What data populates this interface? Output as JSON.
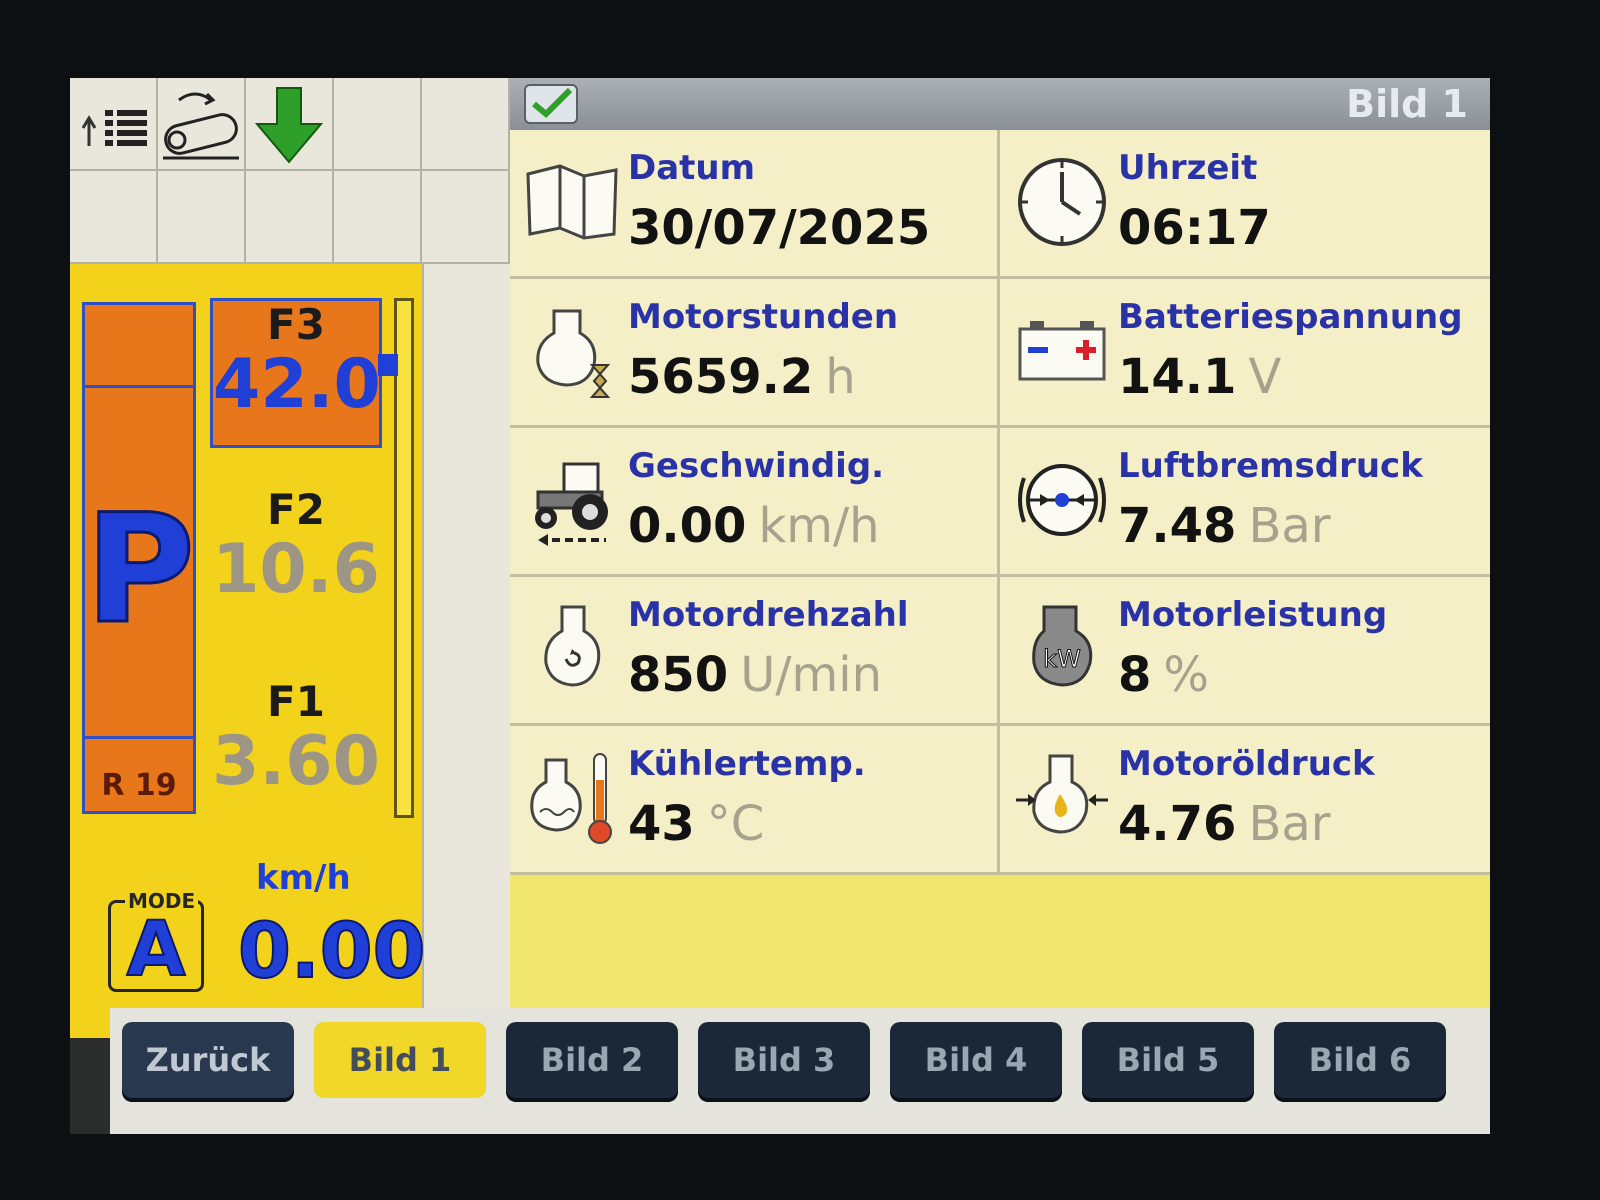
{
  "window": {
    "title": "Bild 1"
  },
  "left_panel": {
    "park_indicator": "P",
    "reverse_gear": "R 19",
    "gears": [
      {
        "name": "F3",
        "value": "42.0",
        "active": true
      },
      {
        "name": "F2",
        "value": "10.6",
        "active": false
      },
      {
        "name": "F1",
        "value": "3.60",
        "active": false
      }
    ],
    "mode_label": "MODE",
    "mode_value": "A",
    "speed_unit": "km/h",
    "speed_value": "0.00"
  },
  "info_items": [
    {
      "label": "Datum",
      "value": "30/07/2025",
      "unit": "",
      "icon": "map-icon"
    },
    {
      "label": "Uhrzeit",
      "value": "06:17",
      "unit": "",
      "icon": "clock-icon"
    },
    {
      "label": "Motorstunden",
      "value": "5659.2",
      "unit": "h",
      "icon": "engine-hours-icon"
    },
    {
      "label": "Batteriespannung",
      "value": "14.1",
      "unit": "V",
      "icon": "battery-icon"
    },
    {
      "label": "Geschwindig.",
      "value": "0.00",
      "unit": "km/h",
      "icon": "tractor-icon"
    },
    {
      "label": "Luftbremsdruck",
      "value": "7.48",
      "unit": "Bar",
      "icon": "air-brake-icon"
    },
    {
      "label": "Motordrehzahl",
      "value": "850",
      "unit": "U/min",
      "icon": "engine-rpm-icon"
    },
    {
      "label": "Motorleistung",
      "value": "8",
      "unit": "%",
      "icon": "engine-power-icon"
    },
    {
      "label": "Kühlertemp.",
      "value": "43",
      "unit": "°C",
      "icon": "coolant-temp-icon"
    },
    {
      "label": "Motoröldruck",
      "value": "4.76",
      "unit": "Bar",
      "icon": "oil-pressure-icon"
    }
  ],
  "tabs": {
    "back": "Zurück",
    "pages": [
      "Bild 1",
      "Bild 2",
      "Bild 3",
      "Bild 4",
      "Bild 5",
      "Bild 6"
    ],
    "active": "Bild 1"
  },
  "power_icon_text": "kW",
  "colors": {
    "accent_blue": "#1f3fd6",
    "panel_yellow": "#f2d21a",
    "active_orange": "#e8761a",
    "label_blue": "#2a32a8",
    "tab_dark": "#1b2838"
  }
}
